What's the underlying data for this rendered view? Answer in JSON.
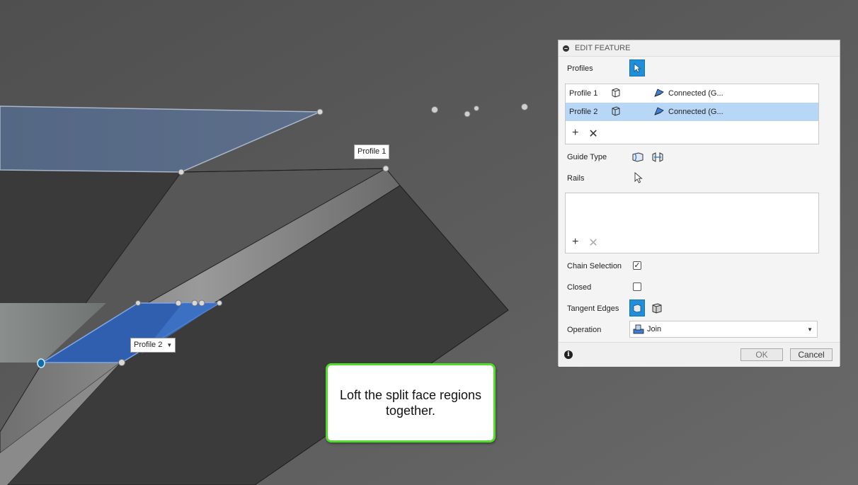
{
  "viewport": {
    "tag_profile1": "Profile 1",
    "tag_profile2": "Profile 2",
    "callout_text": "Loft the split face regions together."
  },
  "panel": {
    "title": "EDIT FEATURE",
    "profiles_label": "Profiles",
    "profile_rows": [
      {
        "name": "Profile 1",
        "condition": "Connected (G..."
      },
      {
        "name": "Profile 2",
        "condition": "Connected (G..."
      }
    ],
    "guide_type_label": "Guide Type",
    "rails_label": "Rails",
    "chain_selection_label": "Chain Selection",
    "chain_selection_checked": true,
    "closed_label": "Closed",
    "closed_checked": false,
    "tangent_edges_label": "Tangent Edges",
    "operation_label": "Operation",
    "operation_value": "Join",
    "ok_label": "OK",
    "cancel_label": "Cancel"
  },
  "colors": {
    "accent_blue": "#1e8fd8",
    "selected_row": "#b8d7f7",
    "callout_border": "#4fdc2a",
    "profile_face": "#2f5fae"
  },
  "icons": [
    "select-arrow-icon",
    "profile-icon",
    "connected-icon",
    "add-icon",
    "remove-icon",
    "guide-rail-icon",
    "centerline-icon",
    "tangent-edges-icon",
    "join-icon",
    "info-icon",
    "dropdown-caret-icon",
    "collapse-icon"
  ]
}
